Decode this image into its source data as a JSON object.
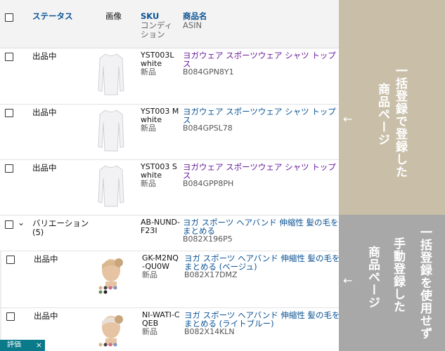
{
  "header": {
    "status": "ステータス",
    "image": "画像",
    "sku": "SKU",
    "condition": "コンディション",
    "name": "商品名",
    "asin": "ASIN"
  },
  "rows": [
    {
      "status": "出品中",
      "sku": "YST003L white",
      "condition": "新品",
      "name": "ヨガウェア スポーツウェア シャツ トップス",
      "asin": "B084GPN8Y1"
    },
    {
      "status": "出品中",
      "sku": "YST003 Mwhite",
      "condition": "新品",
      "name": "ヨガウェア スポーツウェア シャツ トップス",
      "asin": "B084GPSL78"
    },
    {
      "status": "出品中",
      "sku": "YST003 Swhite",
      "condition": "新品",
      "name": "ヨガウェア スポーツウェア シャツ トップス",
      "asin": "B084GPP8PH"
    },
    {
      "status": "バリエーション (5)",
      "sku": "AB-NUND-F23I",
      "condition": "",
      "name": "ヨガ スポーツ ヘアバンド 伸縮性 髪の毛をまとめる",
      "asin": "B082X196P5"
    },
    {
      "status": "出品中",
      "sku": "GK-M2NQ-QU0W",
      "condition": "新品",
      "name": "ヨガ スポーツ ヘアバンド 伸縮性 髪の毛をまとめる (ベージュ)",
      "asin": "B082X17DMZ"
    },
    {
      "status": "出品中",
      "sku": "NI-WATI-CQEB",
      "condition": "新品",
      "name": "ヨガ スポーツ ヘアバンド 伸縮性 髪の毛をまとめる (ライトブルー)",
      "asin": "B082X14KLN"
    }
  ],
  "annotations": {
    "top_lines": [
      "一括登録で登録した",
      "商品ページ"
    ],
    "bottom_lines": [
      "一括登録を使用せず",
      "手動登録した",
      "商品ページ"
    ],
    "arrow": "←"
  },
  "badge": {
    "label": "評価",
    "close": "×"
  },
  "colors": {
    "top_panel": "#c9bfa9",
    "bottom_panel": "#a8a8a8",
    "link": "#0b5394",
    "visited": "#6a1b9a"
  }
}
